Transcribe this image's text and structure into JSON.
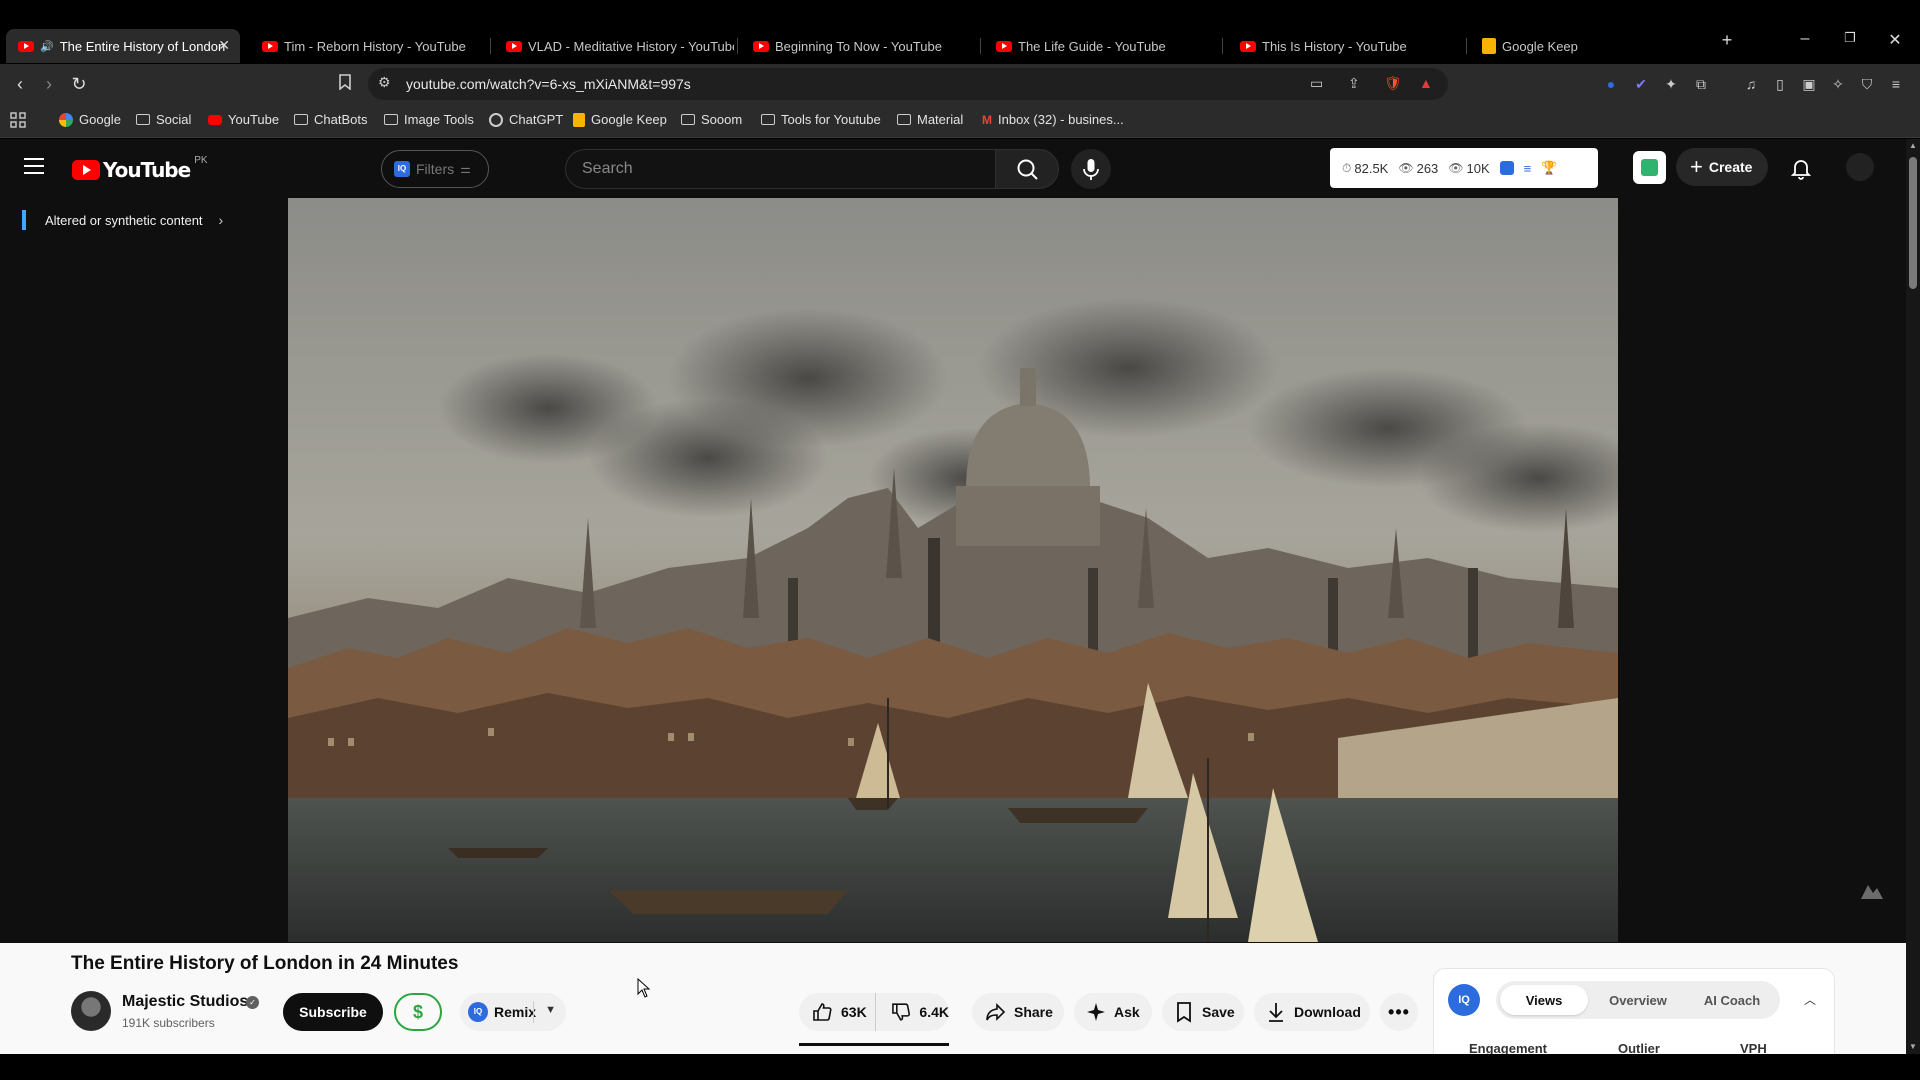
{
  "browser": {
    "tabs": [
      {
        "title": "The Entire History of London",
        "active": true,
        "favicon": "youtube-favicon"
      },
      {
        "title": "Tim - Reborn History - YouTube",
        "active": false,
        "favicon": "youtube-favicon"
      },
      {
        "title": "VLAD - Meditative History - YouTube",
        "active": false,
        "favicon": "youtube-favicon"
      },
      {
        "title": "Beginning To Now - YouTube",
        "active": false,
        "favicon": "youtube-favicon"
      },
      {
        "title": "The Life Guide - YouTube",
        "active": false,
        "favicon": "youtube-favicon"
      },
      {
        "title": "This Is History - YouTube",
        "active": false,
        "favicon": "youtube-favicon"
      },
      {
        "title": "Google Keep",
        "active": false,
        "favicon": "keep-favicon"
      }
    ],
    "new_tab_symbol": "+",
    "url": "youtube.com/watch?v=6-xs_mXiANM&t=997s",
    "bookmarks": [
      {
        "label": "Google",
        "icon": "google-icon"
      },
      {
        "label": "Social",
        "icon": "folder-icon"
      },
      {
        "label": "YouTube",
        "icon": "youtube-icon"
      },
      {
        "label": "ChatBots",
        "icon": "folder-icon"
      },
      {
        "label": "Image Tools",
        "icon": "folder-icon"
      },
      {
        "label": "ChatGPT",
        "icon": "chatgpt-icon"
      },
      {
        "label": "Google Keep",
        "icon": "keep-icon"
      },
      {
        "label": "Sooom",
        "icon": "folder-icon"
      },
      {
        "label": "Tools for Youtube",
        "icon": "folder-icon"
      },
      {
        "label": "Material",
        "icon": "folder-icon"
      },
      {
        "label": "Inbox (32) - busines...",
        "icon": "gmail-icon"
      }
    ]
  },
  "youtube": {
    "logo_text": "YouTube",
    "country_code": "PK",
    "filters_label": "Filters",
    "search_placeholder": "Search",
    "stats": {
      "views": "82.5K",
      "watching": "263",
      "views2": "10K"
    },
    "create_label": "Create",
    "altered_label": "Altered or synthetic content",
    "video": {
      "title": "The Entire History of London in 24 Minutes",
      "channel": "Majestic Studios",
      "subscribers": "191K subscribers",
      "subscribe_label": "Subscribe",
      "dollar_symbol": "$",
      "remix_label": "Remix",
      "likes": "63K",
      "dislikes": "6.4K",
      "share_label": "Share",
      "ask_label": "Ask",
      "save_label": "Save",
      "download_label": "Download"
    },
    "iq_panel": {
      "logo": "IQ",
      "tabs": [
        "Views",
        "Overview",
        "AI Coach"
      ],
      "active_tab": "Views",
      "columns": [
        "Engagement",
        "Outlier",
        "VPH"
      ]
    }
  },
  "colors": {
    "youtube_red": "#ff0000",
    "accent_blue": "#3ea6ff",
    "vidiq_blue": "#2d6cdf",
    "subscribe_green": "#2ba640"
  }
}
